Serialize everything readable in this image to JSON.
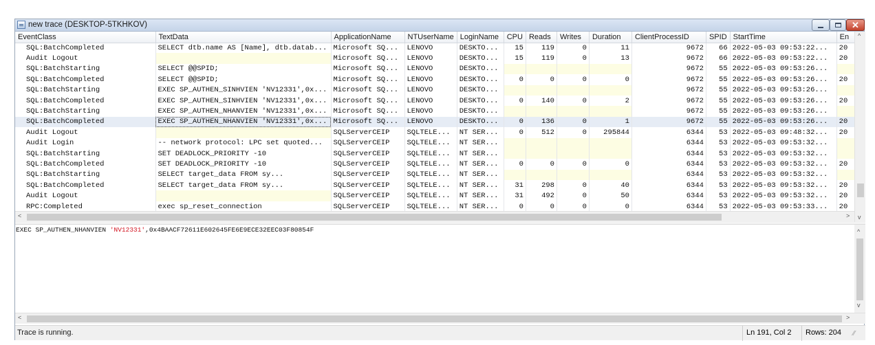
{
  "window": {
    "title": "new trace (DESKTOP-5TKHKOV)"
  },
  "columns": [
    "EventClass",
    "TextData",
    "ApplicationName",
    "NTUserName",
    "LoginName",
    "CPU",
    "Reads",
    "Writes",
    "Duration",
    "ClientProcessID",
    "SPID",
    "StartTime",
    "En"
  ],
  "rows": [
    [
      "SQL:BatchCompleted",
      "SELECT dtb.name AS [Name], dtb.datab...",
      "Microsoft SQ...",
      "LENOVO",
      "DESKTO...",
      "15",
      "119",
      "0",
      "11",
      "9672",
      "66",
      "2022-05-03 09:53:22...",
      "20"
    ],
    [
      "Audit Logout",
      "",
      "Microsoft SQ...",
      "LENOVO",
      "DESKTO...",
      "15",
      "119",
      "0",
      "13",
      "9672",
      "66",
      "2022-05-03 09:53:22...",
      "20"
    ],
    [
      "SQL:BatchStarting",
      "SELECT @@SPID;",
      "Microsoft SQ...",
      "LENOVO",
      "DESKTO...",
      "",
      "",
      "",
      "",
      "9672",
      "55",
      "2022-05-03 09:53:26...",
      ""
    ],
    [
      "SQL:BatchCompleted",
      "SELECT @@SPID;",
      "Microsoft SQ...",
      "LENOVO",
      "DESKTO...",
      "0",
      "0",
      "0",
      "0",
      "9672",
      "55",
      "2022-05-03 09:53:26...",
      "20"
    ],
    [
      "SQL:BatchStarting",
      "EXEC SP_AUTHEN_SINHVIEN 'NV12331',0x...",
      "Microsoft SQ...",
      "LENOVO",
      "DESKTO...",
      "",
      "",
      "",
      "",
      "9672",
      "55",
      "2022-05-03 09:53:26...",
      ""
    ],
    [
      "SQL:BatchCompleted",
      "EXEC SP_AUTHEN_SINHVIEN 'NV12331',0x...",
      "Microsoft SQ...",
      "LENOVO",
      "DESKTO...",
      "0",
      "140",
      "0",
      "2",
      "9672",
      "55",
      "2022-05-03 09:53:26...",
      "20"
    ],
    [
      "SQL:BatchStarting",
      "EXEC SP_AUTHEN_NHANVIEN 'NV12331',0x...",
      "Microsoft SQ...",
      "LENOVO",
      "DESKTO...",
      "",
      "",
      "",
      "",
      "9672",
      "55",
      "2022-05-03 09:53:26...",
      ""
    ],
    [
      "SQL:BatchCompleted",
      "EXEC SP_AUTHEN_NHANVIEN 'NV12331',0x...",
      "Microsoft SQ...",
      "LENOVO",
      "DESKTO...",
      "0",
      "136",
      "0",
      "1",
      "9672",
      "55",
      "2022-05-03 09:53:26...",
      "20"
    ],
    [
      "Audit Logout",
      "",
      "SQLServerCEIP",
      "SQLTELE...",
      "NT SER...",
      "0",
      "512",
      "0",
      "295844",
      "6344",
      "53",
      "2022-05-03 09:48:32...",
      "20"
    ],
    [
      "Audit Login",
      "-- network protocol: LPC  set quoted...",
      "SQLServerCEIP",
      "SQLTELE...",
      "NT SER...",
      "",
      "",
      "",
      "",
      "6344",
      "53",
      "2022-05-03 09:53:32...",
      ""
    ],
    [
      "SQL:BatchStarting",
      "SET DEADLOCK_PRIORITY -10",
      "SQLServerCEIP",
      "SQLTELE...",
      "NT SER...",
      "",
      "",
      "",
      "",
      "6344",
      "53",
      "2022-05-03 09:53:32...",
      ""
    ],
    [
      "SQL:BatchCompleted",
      "SET DEADLOCK_PRIORITY -10",
      "SQLServerCEIP",
      "SQLTELE...",
      "NT SER...",
      "0",
      "0",
      "0",
      "0",
      "6344",
      "53",
      "2022-05-03 09:53:32...",
      "20"
    ],
    [
      "SQL:BatchStarting",
      "SELECT target_data            FROM sy...",
      "SQLServerCEIP",
      "SQLTELE...",
      "NT SER...",
      "",
      "",
      "",
      "",
      "6344",
      "53",
      "2022-05-03 09:53:32...",
      ""
    ],
    [
      "SQL:BatchCompleted",
      "SELECT target_data            FROM sy...",
      "SQLServerCEIP",
      "SQLTELE...",
      "NT SER...",
      "31",
      "298",
      "0",
      "40",
      "6344",
      "53",
      "2022-05-03 09:53:32...",
      "20"
    ],
    [
      "Audit Logout",
      "",
      "SQLServerCEIP",
      "SQLTELE...",
      "NT SER...",
      "31",
      "492",
      "0",
      "50",
      "6344",
      "53",
      "2022-05-03 09:53:32...",
      "20"
    ],
    [
      "RPC:Completed",
      "exec sp_reset_connection",
      "SQLServerCEIP",
      "SQLTELE...",
      "NT SER...",
      "0",
      "0",
      "0",
      "0",
      "6344",
      "53",
      "2022-05-03 09:53:33...",
      "20"
    ]
  ],
  "selected_row": 7,
  "detail": {
    "prefix": "EXEC SP_AUTHEN_NHANVIEN ",
    "string_literal": "'NV12331'",
    "suffix": ",0x4BAACF72611E602645FE6E9ECE32EEC03F80854F"
  },
  "status": {
    "text": "Trace is running.",
    "position": "Ln 191, Col 2",
    "rows": "Rows: 204"
  }
}
